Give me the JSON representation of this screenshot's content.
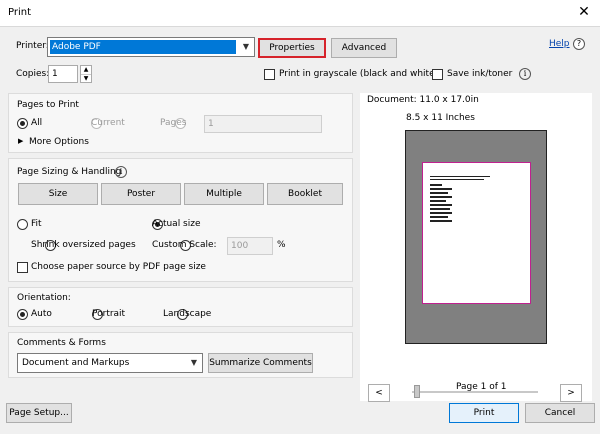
{
  "window": {
    "title": "Print",
    "close_glyph": "✕"
  },
  "printer": {
    "label": "Printer:",
    "value": "Adobe PDF",
    "properties_label": "Properties",
    "advanced_label": "Advanced"
  },
  "help": {
    "label": "Help",
    "icon": "help-icon"
  },
  "copies": {
    "label": "Copies:",
    "value": "1"
  },
  "options": {
    "grayscale_label": "Print in grayscale (black and white)",
    "save_ink_label": "Save ink/toner"
  },
  "pages_to_print": {
    "title": "Pages to Print",
    "all_label": "All",
    "current_label": "Current",
    "pages_label": "Pages",
    "pages_value": "1",
    "more_options_label": "More Options"
  },
  "sizing": {
    "title": "Page Sizing & Handling",
    "tabs": [
      "Size",
      "Poster",
      "Multiple",
      "Booklet"
    ],
    "fit_label": "Fit",
    "actual_size_label": "Actual size",
    "shrink_label": "Shrink oversized pages",
    "custom_scale_label": "Custom Scale:",
    "custom_scale_value": "100",
    "percent": "%",
    "paper_source_label": "Choose paper source by PDF page size"
  },
  "orientation": {
    "title": "Orientation:",
    "auto_label": "Auto",
    "portrait_label": "Portrait",
    "landscape_label": "Landscape"
  },
  "comments": {
    "title": "Comments & Forms",
    "value": "Document and Markups",
    "summarize_label": "Summarize Comments"
  },
  "preview": {
    "document_label": "Document: 11.0 x 17.0in",
    "paper_label": "8.5 x 11 Inches",
    "page_indicator": "Page 1 of 1",
    "prev_glyph": "<",
    "next_glyph": ">"
  },
  "footer": {
    "page_setup_label": "Page Setup...",
    "print_label": "Print",
    "cancel_label": "Cancel"
  },
  "colors": {
    "accent": "#0078d7",
    "focus_border": "#d6232b",
    "page_border": "#c0208f"
  }
}
